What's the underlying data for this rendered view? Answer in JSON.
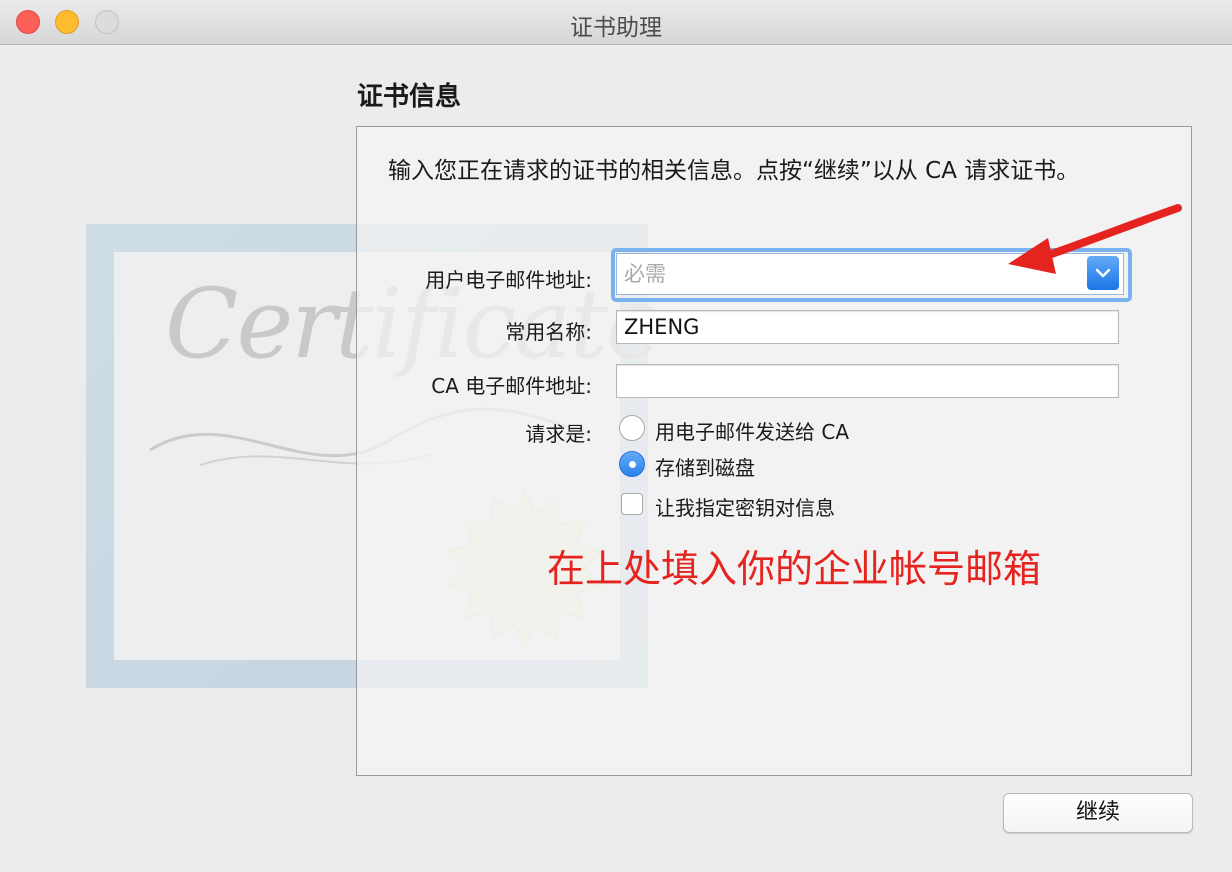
{
  "window": {
    "title": "证书助理"
  },
  "section_title": "证书信息",
  "intro_text": "输入您正在请求的证书的相关信息。点按“继续”以从 CA 请求证书。",
  "certificate_image": {
    "script_text": "Certificate"
  },
  "form": {
    "email_label": "用户电子邮件地址:",
    "email_placeholder": "必需",
    "common_name_label": "常用名称:",
    "common_name_value": "ZHENG",
    "ca_email_label": "CA 电子邮件地址:",
    "ca_email_value": "",
    "request_label": "请求是:",
    "option_email_ca": "用电子邮件发送给 CA",
    "option_save_disk": "存储到磁盘",
    "option_specify_key": "让我指定密钥对信息",
    "selected_option": "存储到磁盘",
    "specify_key_checked": false
  },
  "annotation": {
    "text": "在上处填入你的企业帐号邮箱",
    "color": "#e5231f"
  },
  "buttons": {
    "continue_label": "继续"
  },
  "colors": {
    "accent": "#2a82ee",
    "focus_ring": "#7ab2f0"
  }
}
